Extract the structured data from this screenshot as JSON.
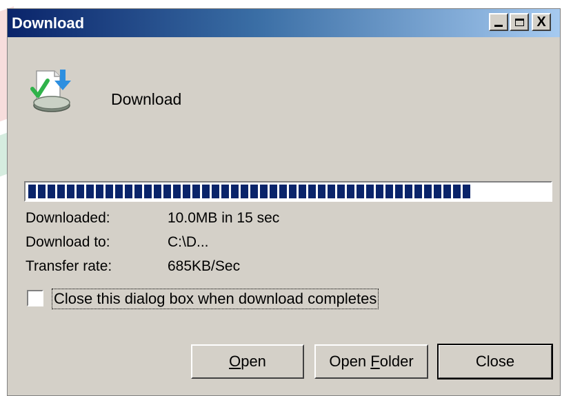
{
  "window": {
    "title": "Download",
    "controls": {
      "minimize": "_",
      "maximize": "□",
      "close": "X"
    }
  },
  "dialog": {
    "heading": "Download",
    "progress_fraction": 0.85,
    "details": [
      {
        "label": "Downloaded:",
        "value": "10.0MB in 15 sec"
      },
      {
        "label": "Download to:",
        "value": "C:\\D..."
      },
      {
        "label": "Transfer rate:",
        "value": "685KB/Sec"
      }
    ],
    "checkbox": {
      "label": "Close this dialog box when download completes",
      "checked": false
    }
  },
  "buttons": {
    "open": {
      "mnemonic": "O",
      "rest": "pen"
    },
    "open_folder": {
      "prefix": "Open ",
      "mnemonic": "F",
      "rest": "older"
    },
    "close": "Close"
  },
  "icons": {
    "app": "download-complete-icon"
  },
  "colors": {
    "progress": "#0a246a",
    "window_bg": "#d4d0c8",
    "title_start": "#0a246a",
    "title_end": "#a6caf0"
  }
}
